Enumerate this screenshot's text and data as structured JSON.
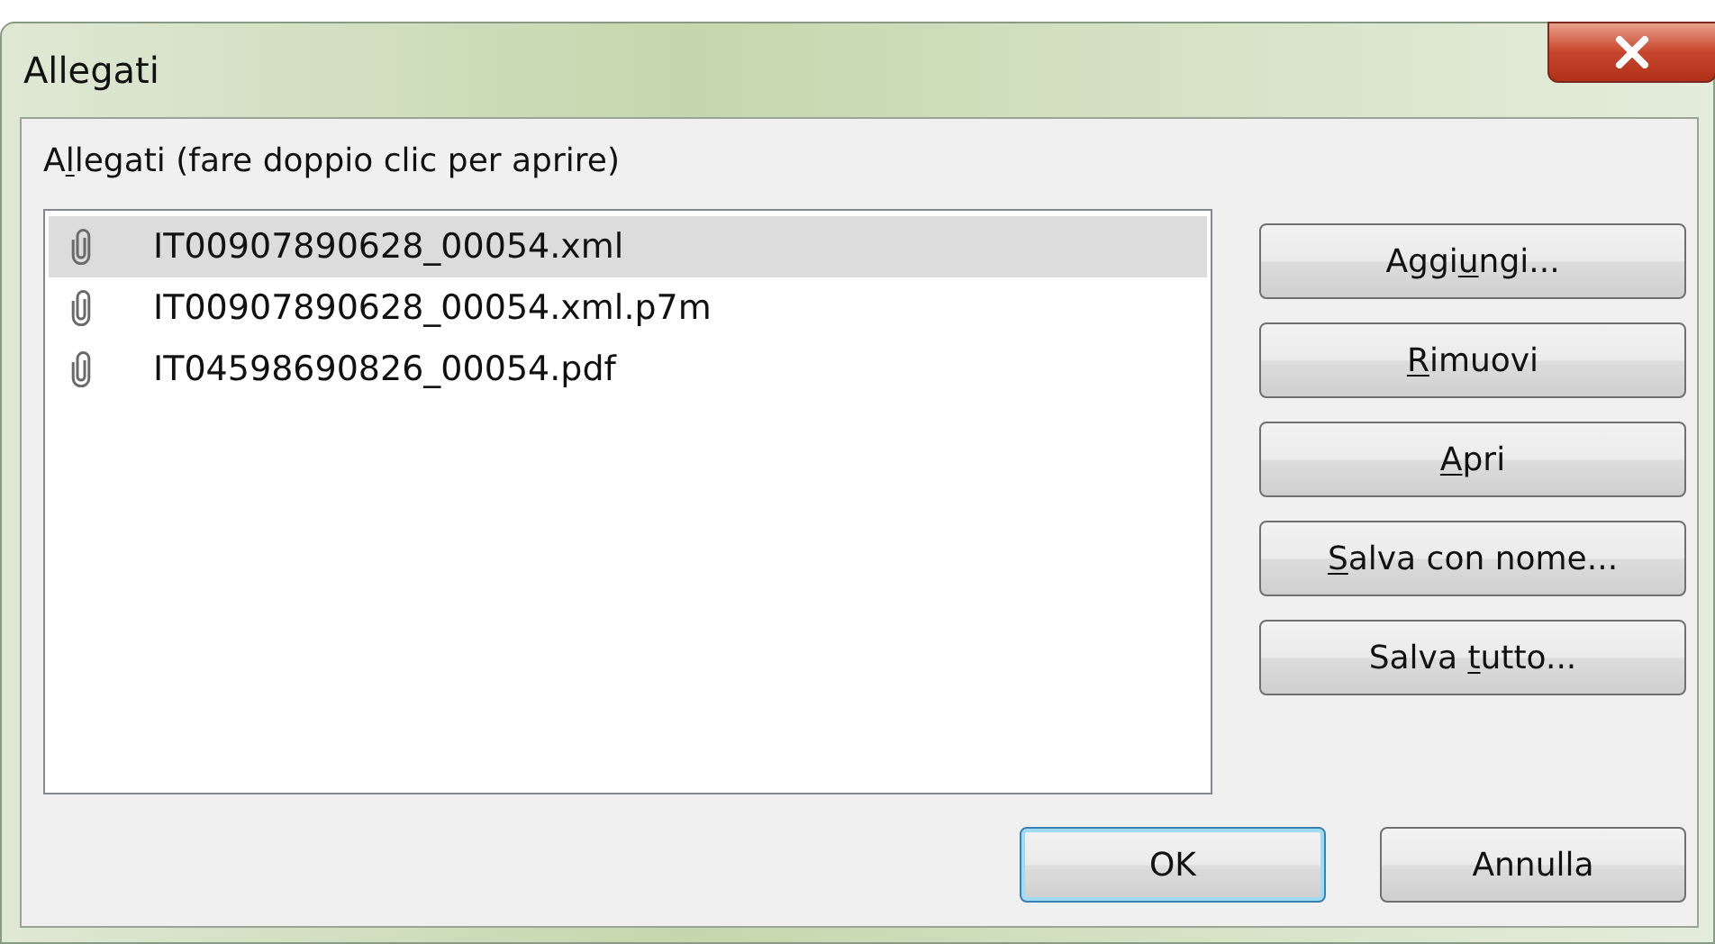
{
  "window": {
    "title": "Allegati"
  },
  "list_label": {
    "before": "A",
    "key": "l",
    "after": "legati (fare doppio clic per aprire)"
  },
  "attachments": [
    {
      "name": "IT00907890628_00054.xml",
      "selected": true
    },
    {
      "name": "IT00907890628_00054.xml.p7m",
      "selected": false
    },
    {
      "name": "IT04598690826_00054.pdf",
      "selected": false
    }
  ],
  "side_buttons": [
    {
      "before": "Aggi",
      "key": "u",
      "after": "ngi..."
    },
    {
      "key": "R",
      "after": "imuovi"
    },
    {
      "key": "A",
      "after": "pri"
    },
    {
      "key": "S",
      "after": "alva con nome..."
    },
    {
      "before": "Salva ",
      "key": "t",
      "after": "utto..."
    }
  ],
  "footer_buttons": [
    {
      "label": "OK",
      "default": true
    },
    {
      "label": "Annulla",
      "default": false
    }
  ]
}
